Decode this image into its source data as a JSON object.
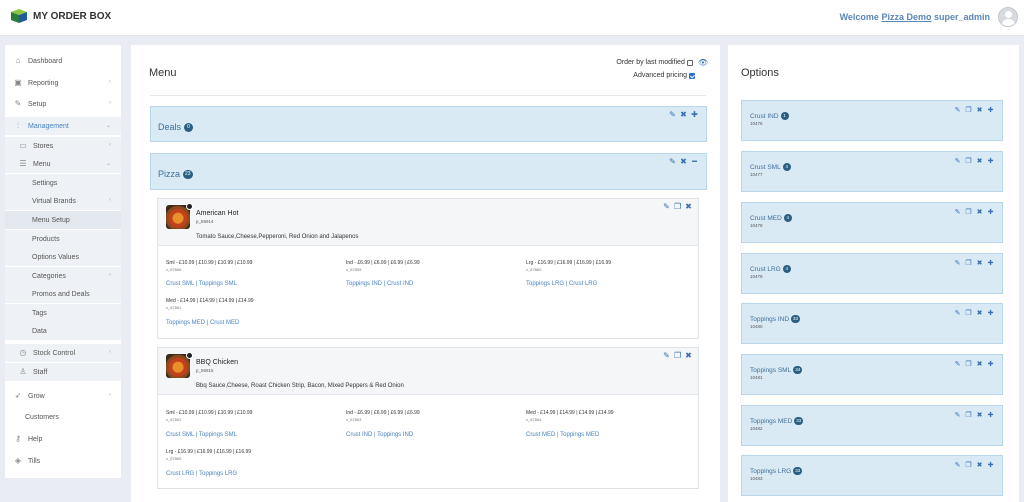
{
  "header": {
    "app_title": "MY ORDER BOX",
    "welcome_prefix": "Welcome",
    "user_link": "Pizza Demo",
    "role": "super_admin"
  },
  "sidebar": {
    "items": [
      {
        "label": "Dashboard",
        "icon": "home-icon",
        "chevron": false
      },
      {
        "label": "Reporting",
        "icon": "chart-icon",
        "chevron": true
      },
      {
        "label": "Setup",
        "icon": "wrench-icon",
        "chevron": true
      },
      {
        "label": "Management",
        "icon": "sliders-icon",
        "chevron": true
      },
      {
        "label": "Stores",
        "icon": "folder-icon",
        "chevron": true
      },
      {
        "label": "Menu",
        "icon": "list-icon",
        "chevron": true
      },
      {
        "label": "Settings",
        "chevron": false
      },
      {
        "label": "Virtual Brands",
        "chevron": true
      },
      {
        "label": "Menu Setup",
        "chevron": false
      },
      {
        "label": "Products",
        "chevron": false
      },
      {
        "label": "Options Values",
        "chevron": false
      },
      {
        "label": "Categories",
        "chevron": true
      },
      {
        "label": "Promos and Deals",
        "chevron": false
      },
      {
        "label": "Tags",
        "chevron": false
      },
      {
        "label": "Data",
        "chevron": false
      },
      {
        "label": "Stock Control",
        "icon": "clock-icon",
        "chevron": true
      },
      {
        "label": "Staff",
        "icon": "user-icon",
        "chevron": false
      },
      {
        "label": "Grow",
        "icon": "rocket-icon",
        "chevron": true
      },
      {
        "label": "Customers",
        "chevron": false
      },
      {
        "label": "Help",
        "icon": "key-icon",
        "chevron": false
      },
      {
        "label": "Tills",
        "icon": "layers-icon",
        "chevron": false
      }
    ]
  },
  "menu": {
    "title": "Menu",
    "order_by_last_modified": "Order by last modified",
    "order_checked": false,
    "advanced_pricing": "Advanced pricing",
    "advanced_checked": true,
    "categories": [
      {
        "name": "Deals",
        "count": "0"
      },
      {
        "name": "Pizza",
        "count": "23"
      }
    ],
    "products": [
      {
        "name": "American Hot",
        "code": "p_55914",
        "description": "Tomato Sauce,Cheese,Pepperoni, Red Onion and Jalapenos",
        "variants": [
          {
            "price": "Sml - £10.99 | £10.99 | £10.99 | £10.99",
            "code": "v_87856",
            "link1": "Crust SML",
            "link2": "Toppings SML"
          },
          {
            "price": "Ind - £6.99 | £6.99 | £6.99 | £6.99",
            "code": "v_87859",
            "link1": "Toppings IND",
            "link2": "Crust IND"
          },
          {
            "price": "Lrg - £16.99 | £16.99 | £16.99 | £16.99",
            "code": "v_87860",
            "link1": "Toppings LRG",
            "link2": "Crust LRG"
          },
          {
            "price": "Med - £14.99 | £14.99 | £14.99 | £14.99",
            "code": "v_87861",
            "link1": "Toppings MED",
            "link2": "Crust MED"
          }
        ]
      },
      {
        "name": "BBQ Chicken",
        "code": "p_55915",
        "description": "Bbq Sauce,Cheese, Roast Chicken Strip, Bacon, Mixed Peppers & Red Onion",
        "variants": [
          {
            "price": "Sml - £10.99 | £10.99 | £10.99 | £10.99",
            "code": "v_87862",
            "link1": "Crust SML",
            "link2": "Toppings SML"
          },
          {
            "price": "Ind - £6.99 | £6.99 | £6.99 | £6.99",
            "code": "v_87863",
            "link1": "Crust IND",
            "link2": "Toppings IND"
          },
          {
            "price": "Med - £14.99 | £14.99 | £14.99 | £14.99",
            "code": "v_87864",
            "link1": "Crust MED",
            "link2": "Toppings MED"
          },
          {
            "price": "Lrg - £16.99 | £16.99 | £16.99 | £16.99",
            "code": "v_87865",
            "link1": "Crust LRG",
            "link2": "Toppings LRG"
          }
        ]
      }
    ]
  },
  "options": {
    "title": "Options",
    "items": [
      {
        "name": "Crust IND",
        "count": "1",
        "code": "10476"
      },
      {
        "name": "Crust SML",
        "count": "4",
        "code": "10477"
      },
      {
        "name": "Crust MED",
        "count": "4",
        "code": "10478"
      },
      {
        "name": "Crust LRG",
        "count": "4",
        "code": "10479"
      },
      {
        "name": "Toppings IND",
        "count": "33",
        "code": "10480"
      },
      {
        "name": "Toppings SML",
        "count": "34",
        "code": "10481"
      },
      {
        "name": "Toppings MED",
        "count": "33",
        "code": "10482"
      },
      {
        "name": "Toppings LRG",
        "count": "33",
        "code": "10483"
      }
    ]
  },
  "colors": {
    "accent": "#5b86b8",
    "card_bg": "#d9eaf5",
    "badge": "#2b5f82",
    "link": "#4a82c0"
  }
}
